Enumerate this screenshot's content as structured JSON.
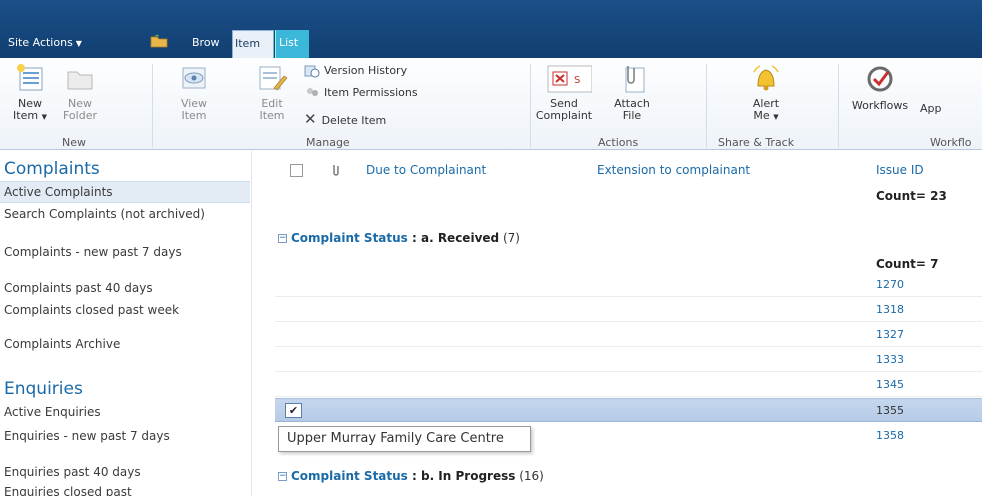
{
  "topbar": {
    "site_actions": "Site Actions",
    "browse": "Brow",
    "tab_item": "Item",
    "tab_list": "List"
  },
  "ribbon": {
    "new_item": [
      "New",
      "Item"
    ],
    "new_folder": [
      "New",
      "Folder"
    ],
    "view_item": [
      "View",
      "Item"
    ],
    "edit_item": [
      "Edit",
      "Item"
    ],
    "version_history": "Version History",
    "item_permissions": "Item Permissions",
    "delete_item": "Delete Item",
    "send_complaint": [
      "Send",
      "Complaint"
    ],
    "attach_file": [
      "Attach",
      "File"
    ],
    "alert_me": [
      "Alert",
      "Me"
    ],
    "workflows": "Workflows",
    "approve_partial": "App",
    "groups": {
      "new": "New",
      "manage": "Manage",
      "actions": "Actions",
      "share_track": "Share & Track",
      "workflows": "Workflo"
    }
  },
  "leftnav": {
    "complaints_heading": "Complaints",
    "complaints_items": [
      "Active Complaints",
      "Search Complaints (not archived)",
      "Complaints - new past 7 days",
      "Complaints past 40 days",
      "Complaints closed past week",
      "Complaints Archive"
    ],
    "enquiries_heading": "Enquiries",
    "enquiries_items": [
      "Active Enquiries",
      "Enquiries - new past 7 days",
      "Enquiries past 40 days",
      "Enquiries closed past"
    ]
  },
  "list": {
    "columns": {
      "due": "Due to Complainant",
      "extension": "Extension to complainant",
      "issue_id": "Issue ID"
    },
    "total_count": "Count= 23",
    "group1": {
      "field": "Complaint Status",
      "sep": " : ",
      "value": "a. Received",
      "count": "(7)",
      "count_label": "Count= 7",
      "ids": [
        "1270",
        "1318",
        "1327",
        "1333",
        "1345",
        "1355",
        "1358"
      ]
    },
    "group2": {
      "field": "Complaint Status",
      "sep": " : ",
      "value": "b. In Progress",
      "count": "(16)"
    },
    "tooltip": "Upper Murray Family Care Centre",
    "selected_check": "✔"
  }
}
